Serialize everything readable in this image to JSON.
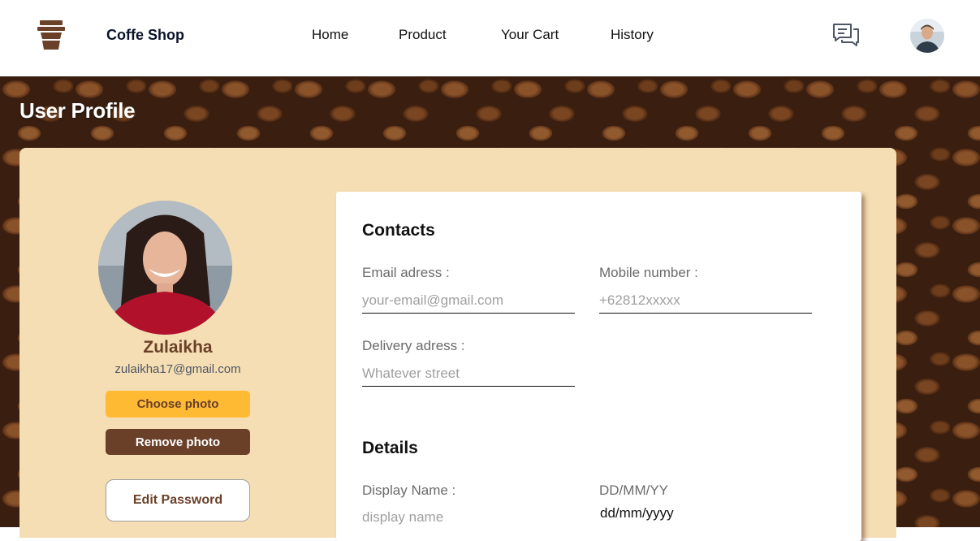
{
  "navbar": {
    "brand": "Coffe Shop",
    "links": [
      "Home",
      "Product",
      "Your Cart",
      "History"
    ],
    "icons": {
      "logo": "coffee-cup-icon",
      "chat": "chat-bubbles-icon",
      "avatar": "user-avatar"
    }
  },
  "page": {
    "title": "User Profile"
  },
  "profile": {
    "name": "Zulaikha",
    "email": "zulaikha17@gmail.com",
    "choose_photo": "Choose photo",
    "remove_photo": "Remove photo",
    "edit_password": "Edit Password"
  },
  "contacts": {
    "title": "Contacts",
    "email_label": "Email adress :",
    "email_placeholder": "your-email@gmail.com",
    "mobile_label": "Mobile number :",
    "mobile_placeholder": "+62812xxxxx",
    "delivery_label": "Delivery adress :",
    "delivery_placeholder": "Whatever street"
  },
  "details": {
    "title": "Details",
    "display_name_label": "Display Name :",
    "display_name_placeholder": "display name",
    "date_label": "DD/MM/YY",
    "date_placeholder": "dd/mm/yyyy"
  },
  "colors": {
    "brown": "#6a4029",
    "yellow": "#ffba33",
    "panel": "#f5deb3",
    "navy": "#0b132a"
  }
}
